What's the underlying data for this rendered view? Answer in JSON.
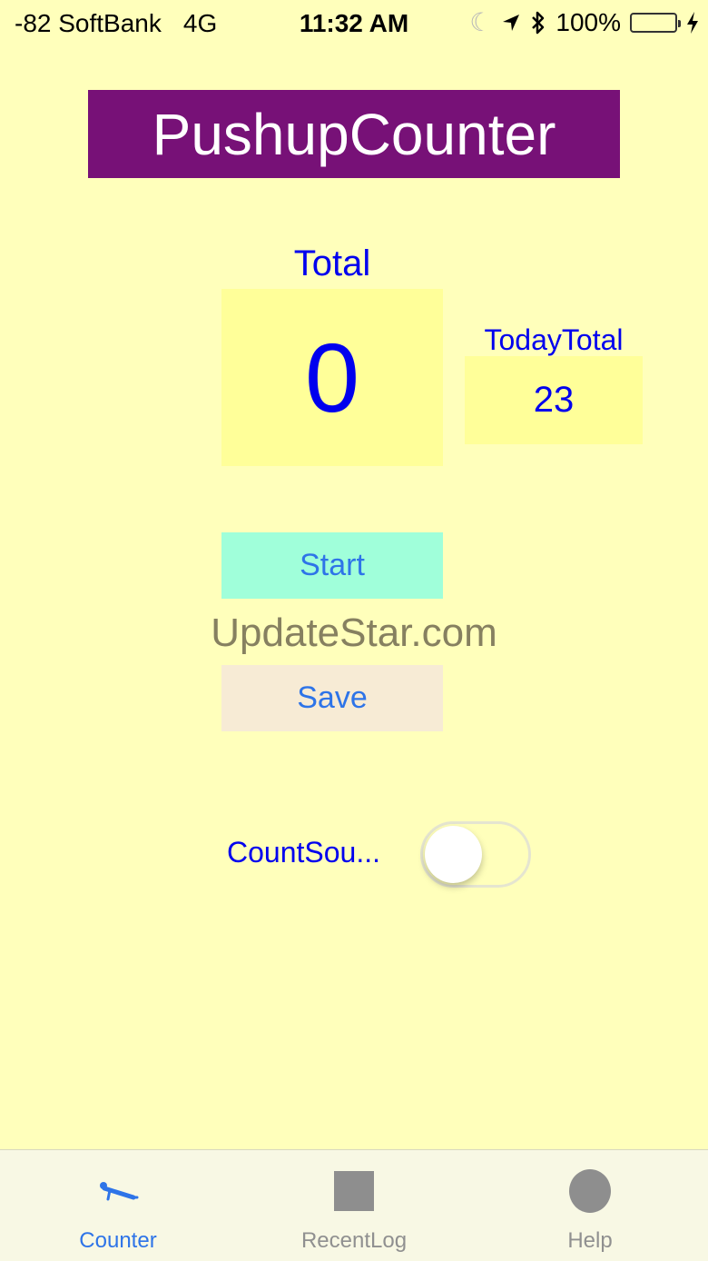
{
  "status_bar": {
    "signal": "-82 SoftBank",
    "network": "4G",
    "time": "11:32 AM",
    "battery_text": "100%",
    "icons": [
      "moon-icon",
      "location-arrow-icon",
      "bluetooth-icon",
      "battery-icon",
      "charging-icon"
    ]
  },
  "app": {
    "title": "PushupCounter"
  },
  "counter": {
    "total_label": "Total",
    "total_value": "0",
    "today_label": "TodayTotal",
    "today_value": "23"
  },
  "buttons": {
    "start_label": "Start",
    "save_label": "Save"
  },
  "watermark": "UpdateStar.com",
  "settings": {
    "count_sound_label": "CountSou...",
    "count_sound_on": false
  },
  "tabs": [
    {
      "label": "Counter",
      "icon": "pushup-icon",
      "active": true
    },
    {
      "label": "RecentLog",
      "icon": "square-icon",
      "active": false
    },
    {
      "label": "Help",
      "icon": "circle-icon",
      "active": false
    }
  ],
  "colors": {
    "background": "#FFFFBB",
    "title_bg": "#771177",
    "accent_blue": "#0000EE",
    "link_blue": "#2E74E8",
    "start_bg": "#A0FFDA",
    "save_bg": "#F7EBD5"
  }
}
